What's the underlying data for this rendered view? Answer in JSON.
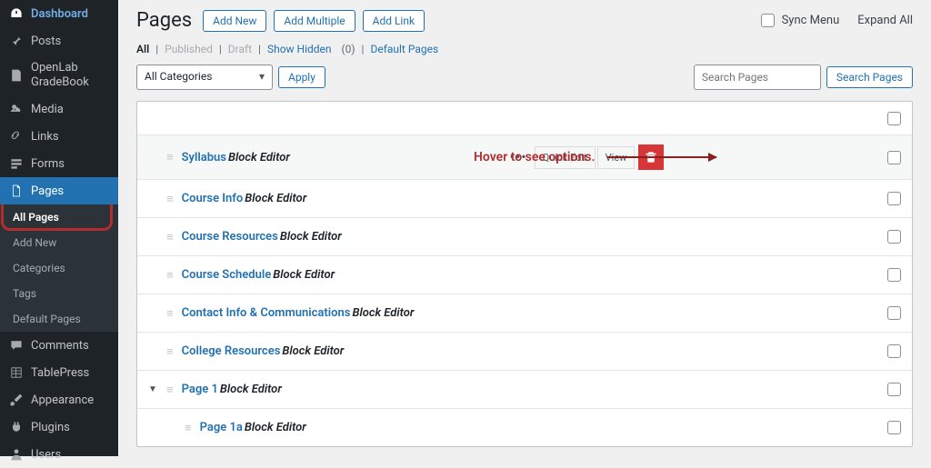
{
  "sidebar": {
    "items": [
      {
        "label": "Dashboard",
        "icon": "dash"
      },
      {
        "label": "Posts",
        "icon": "pin"
      },
      {
        "label": "OpenLab GradeBook",
        "icon": "doc"
      },
      {
        "label": "Media",
        "icon": "media"
      },
      {
        "label": "Links",
        "icon": "link"
      },
      {
        "label": "Forms",
        "icon": "forms"
      },
      {
        "label": "Pages",
        "icon": "page"
      },
      {
        "label": "Comments",
        "icon": "comment"
      },
      {
        "label": "TablePress",
        "icon": "table"
      },
      {
        "label": "Appearance",
        "icon": "brush"
      },
      {
        "label": "Plugins",
        "icon": "plug"
      },
      {
        "label": "Users",
        "icon": "user"
      }
    ],
    "subs": [
      {
        "label": "All Pages"
      },
      {
        "label": "Add New"
      },
      {
        "label": "Categories"
      },
      {
        "label": "Tags"
      },
      {
        "label": "Default Pages"
      }
    ]
  },
  "header": {
    "title": "Pages",
    "add_new": "Add New",
    "add_multiple": "Add Multiple",
    "add_link": "Add Link",
    "sync_menu": "Sync Menu",
    "expand_all": "Expand All"
  },
  "filters": {
    "all": "All",
    "published": "Published",
    "draft": "Draft",
    "show_hidden": "Show Hidden",
    "hidden_count": "(0)",
    "default_pages": "Default Pages"
  },
  "controls": {
    "all_categories": "All Categories",
    "apply": "Apply",
    "search_placeholder": "Search Pages",
    "search_btn": "Search Pages"
  },
  "annotation": "Hover to see options.",
  "actions": {
    "more": "•••",
    "quick_edit": "Quick Edit",
    "view": "View"
  },
  "editor_tag": "Block Editor",
  "rows": [
    {
      "title": "Syllabus",
      "indent": 1,
      "hover": true
    },
    {
      "title": "Course Info",
      "indent": 1
    },
    {
      "title": "Course Resources",
      "indent": 1
    },
    {
      "title": "Course Schedule",
      "indent": 1
    },
    {
      "title": "Contact Info & Communications",
      "indent": 1
    },
    {
      "title": "College Resources",
      "indent": 1
    },
    {
      "title": "Page 1",
      "indent": 0,
      "expand": true
    },
    {
      "title": "Page 1a",
      "indent": 2
    }
  ]
}
